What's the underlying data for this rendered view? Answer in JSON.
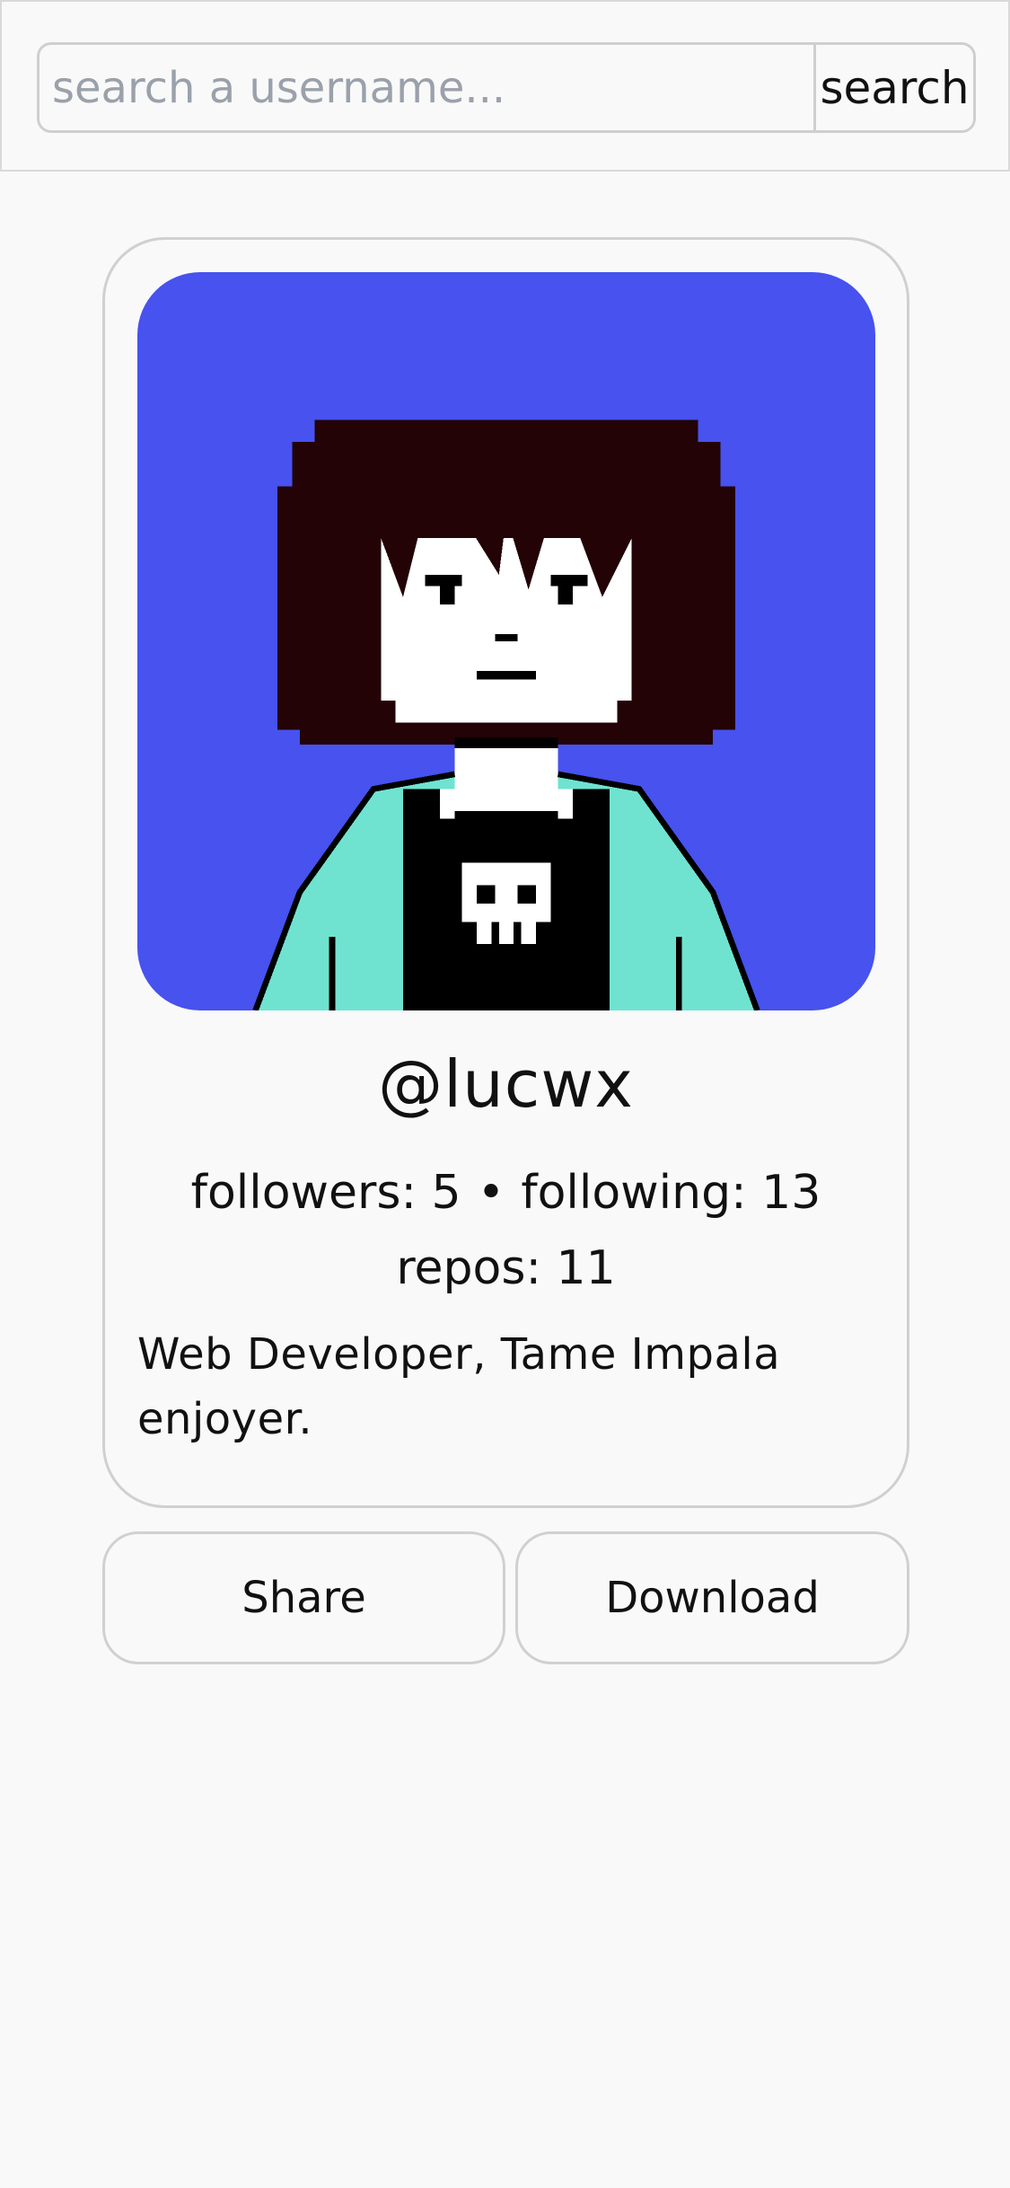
{
  "search": {
    "placeholder": "search a username...",
    "button_label": "search"
  },
  "profile": {
    "avatar_icon": "pixel-art-avatar",
    "username": "@lucwx",
    "followers_label": "followers: 5",
    "separator": "•",
    "following_label": "following: 13",
    "repos_label": "repos: 11",
    "bio": "Web Developer, Tame Impala enjoyer."
  },
  "actions": {
    "share_label": "Share",
    "download_label": "Download"
  },
  "colors": {
    "background": "#f9f9f9",
    "avatar_background": "#4752ef",
    "hair": "#230306",
    "jacket": "#6fe3d0",
    "border": "#d0d0d0"
  }
}
